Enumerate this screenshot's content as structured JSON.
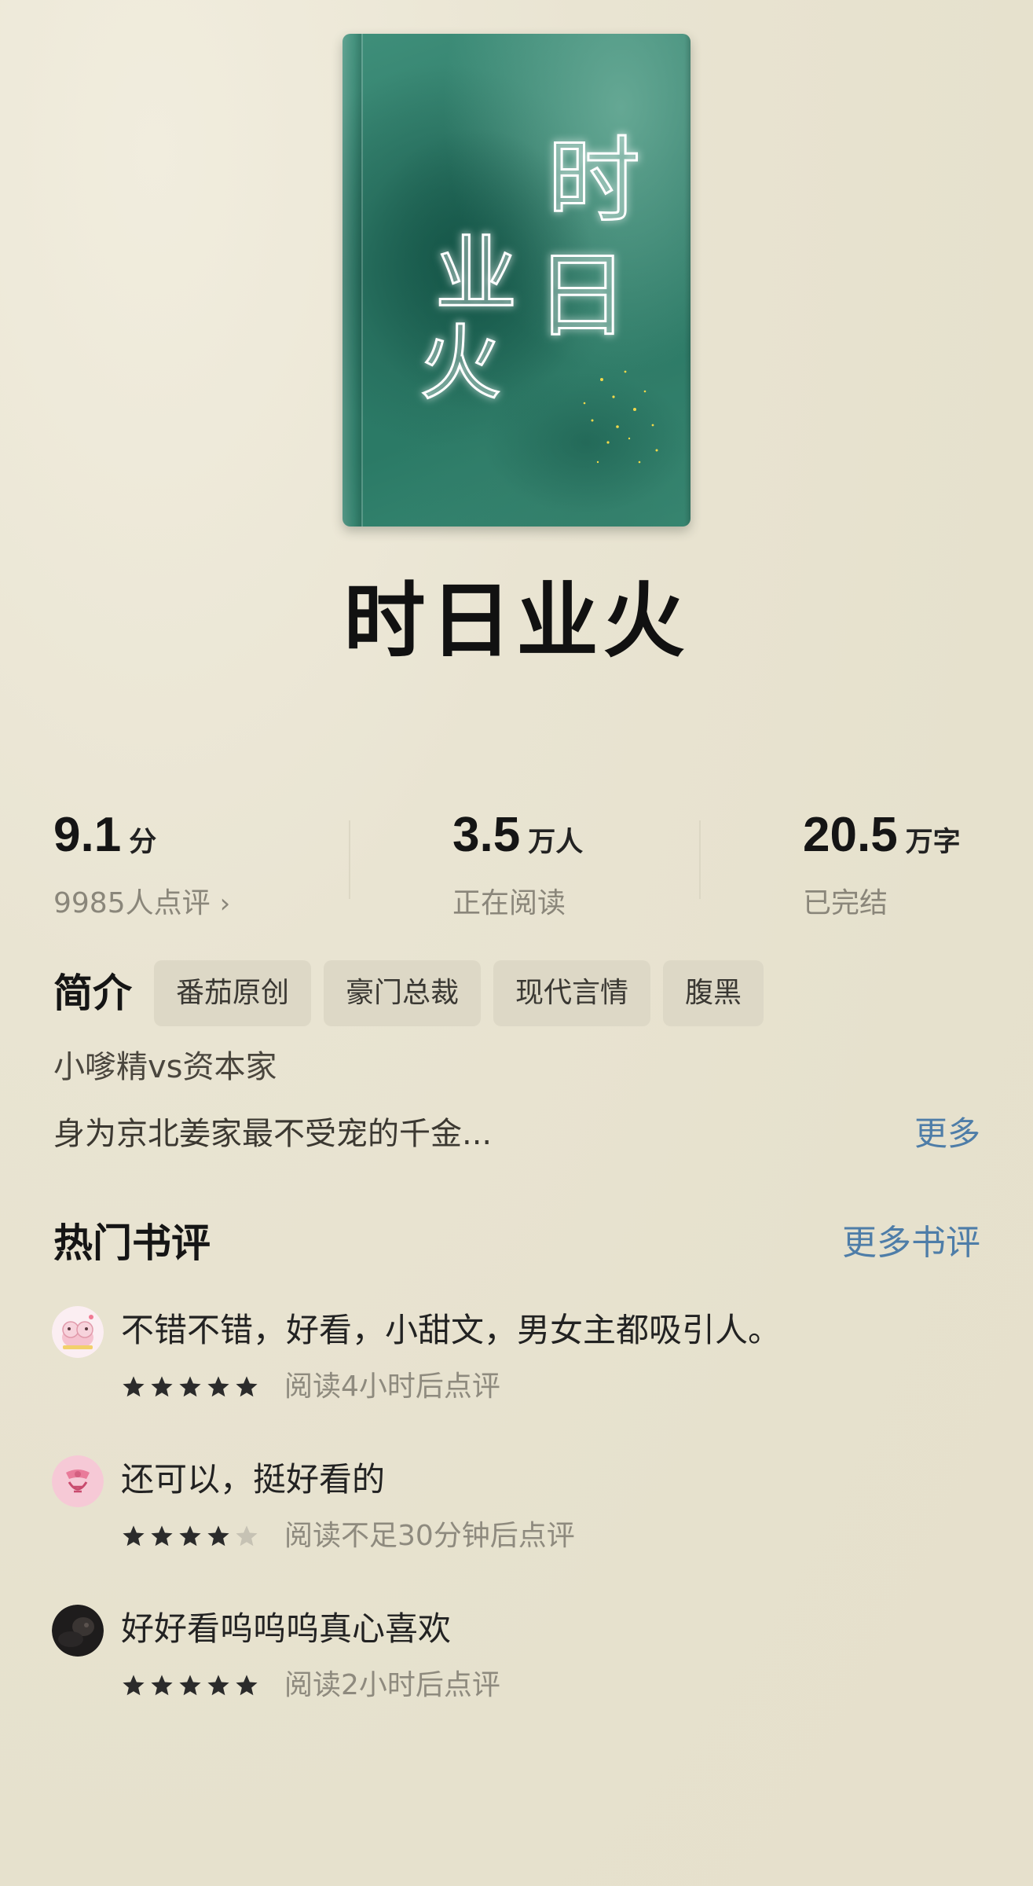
{
  "book": {
    "title": "时日业火",
    "cover": {
      "title_glyphs": [
        "时",
        "日",
        "业",
        "火"
      ],
      "colors": {
        "base": "#2c7866",
        "accent": "#f2d94a",
        "glow": "#ffffff"
      }
    }
  },
  "stats": {
    "rating": {
      "value": "9.1",
      "unit": "分",
      "sub": "9985人点评",
      "chevron": "›"
    },
    "readers": {
      "value": "3.5",
      "unit": "万人",
      "sub": "正在阅读"
    },
    "length": {
      "value": "20.5",
      "unit": "万字",
      "sub": "已完结"
    }
  },
  "intro": {
    "label": "简介",
    "tags": [
      "番茄原创",
      "豪门总裁",
      "现代言情",
      "腹黑"
    ],
    "line1": "小嗲精vs资本家",
    "line2": "身为京北姜家最不受宠的千金...",
    "more": "更多"
  },
  "reviews": {
    "title": "热门书评",
    "more": "更多书评",
    "items": [
      {
        "text": "不错不错，好看，小甜文，男女主都吸引人。",
        "stars": 5,
        "time": "阅读4小时后点评",
        "avatar": "pink-cartoon-avatar"
      },
      {
        "text": "还可以，挺好看的",
        "stars": 4,
        "time": "阅读不足30分钟后点评",
        "avatar": "pink-bow-avatar"
      },
      {
        "text": "好好看呜呜呜真心喜欢",
        "stars": 5,
        "time": "阅读2小时后点评",
        "avatar": "dark-photo-avatar"
      }
    ]
  },
  "colors": {
    "background": "#e8e3d0",
    "link": "#4e7da8",
    "tag_bg": "#ddd8c6",
    "muted_text": "#8a867a",
    "star_filled": "#2b2b2b",
    "star_empty": "#c6c2b4"
  }
}
